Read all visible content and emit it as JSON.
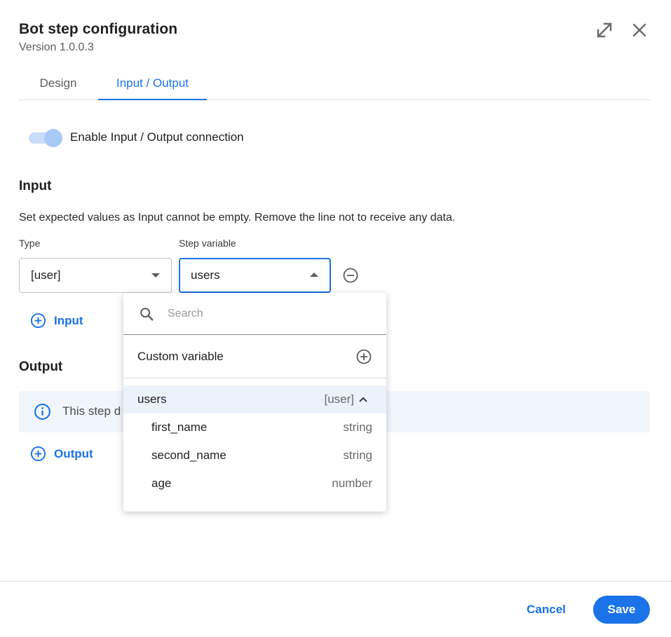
{
  "header": {
    "title": "Bot step configuration",
    "version": "Version 1.0.0.3"
  },
  "tabs": [
    {
      "label": "Design",
      "active": false
    },
    {
      "label": "Input / Output",
      "active": true
    }
  ],
  "toggle": {
    "label": "Enable Input / Output connection",
    "enabled": true
  },
  "input": {
    "title": "Input",
    "description": "Set expected values as Input cannot be empty. Remove the line not to receive any data.",
    "type_label": "Type",
    "type_value": "[user]",
    "variable_label": "Step variable",
    "variable_value": "users",
    "add_label": "Input"
  },
  "dropdown": {
    "search_placeholder": "Search",
    "custom_variable_label": "Custom variable",
    "group": {
      "name": "users",
      "type": "[user]",
      "expanded": true
    },
    "items": [
      {
        "name": "first_name",
        "type": "string"
      },
      {
        "name": "second_name",
        "type": "string"
      },
      {
        "name": "age",
        "type": "number"
      }
    ]
  },
  "output": {
    "title": "Output",
    "info_text": "This step d",
    "add_label": "Output"
  },
  "footer": {
    "cancel_label": "Cancel",
    "save_label": "Save"
  },
  "colors": {
    "accent": "#1a73e8",
    "info_bg": "#f1f6fd",
    "selected_row_bg": "#ecf2fc"
  },
  "icons": [
    "expand-icon",
    "close-icon",
    "minus-circle-icon",
    "plus-circle-icon",
    "info-icon",
    "search-icon",
    "chevron-up-icon",
    "caret-down-icon",
    "caret-up-icon"
  ]
}
